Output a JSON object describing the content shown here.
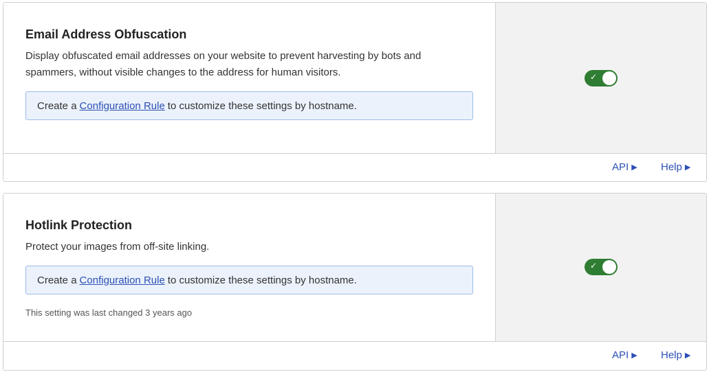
{
  "cards": [
    {
      "title": "Email Address Obfuscation",
      "description": "Display obfuscated email addresses on your website to prevent harvesting by bots and spammers, without visible changes to the address for human visitors.",
      "notice": {
        "prefix": "Create a",
        "link": "Configuration Rule",
        "suffix": "to customize these settings by hostname."
      },
      "toggle_state": "on",
      "footer": {
        "api": "API",
        "help": "Help"
      }
    },
    {
      "title": "Hotlink Protection",
      "description": "Protect your images from off-site linking.",
      "notice": {
        "prefix": "Create a",
        "link": "Configuration Rule",
        "suffix": "to customize these settings by hostname."
      },
      "meta": "This setting was last changed 3 years ago",
      "toggle_state": "on",
      "footer": {
        "api": "API",
        "help": "Help"
      }
    }
  ],
  "colors": {
    "toggle_on": "#2f7d32",
    "link": "#2c4fb5",
    "notice_bg": "#ebf2fc",
    "side_bg": "#f2f2f2"
  },
  "icons": {
    "toggle_check": "check-icon",
    "footer_arrow": "caret-right-icon"
  }
}
